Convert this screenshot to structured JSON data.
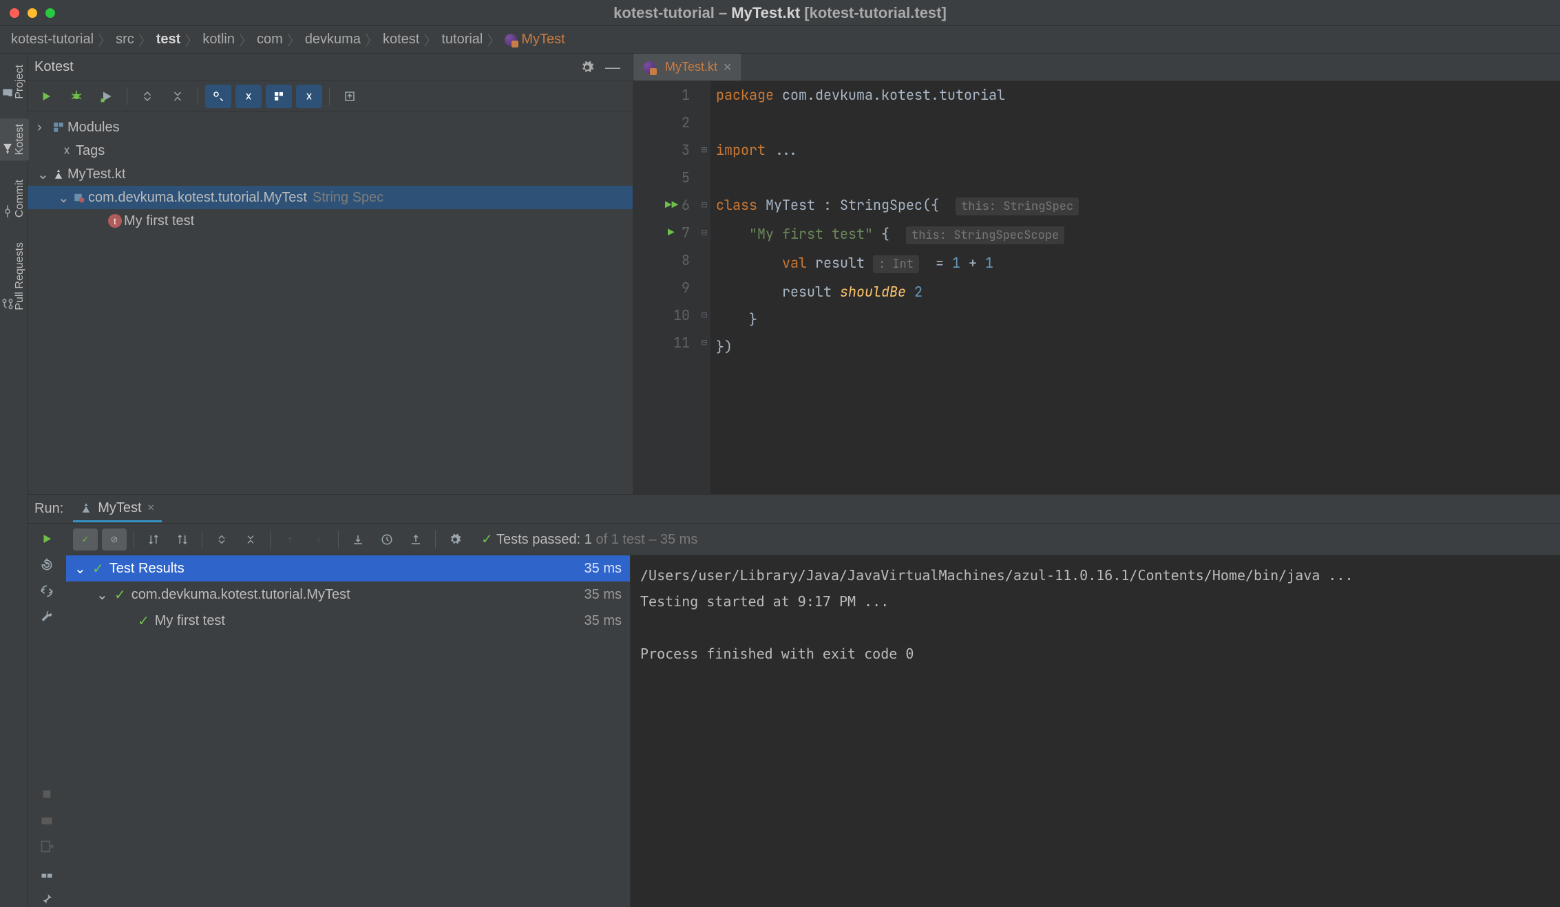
{
  "window": {
    "title_prefix": "kotest-tutorial – ",
    "title_file": "MyTest.kt",
    "title_suffix": " [kotest-tutorial.test]"
  },
  "breadcrumb": {
    "items": [
      "kotest-tutorial",
      "src",
      "test",
      "kotlin",
      "com",
      "devkuma",
      "kotest",
      "tutorial"
    ],
    "active": "MyTest"
  },
  "left_tabs": {
    "project": "Project",
    "kotest": "Kotest",
    "commit": "Commit",
    "pull_requests": "Pull Requests"
  },
  "kotest_panel": {
    "title": "Kotest",
    "tree": {
      "modules": "Modules",
      "tags": "Tags",
      "file": "MyTest.kt",
      "class": "com.devkuma.kotest.tutorial.MyTest",
      "class_spec": "String Spec",
      "test": "My first test"
    }
  },
  "editor": {
    "tab_name": "MyTest.kt",
    "code": {
      "package_kw": "package",
      "package_name": " com.devkuma.kotest.tutorial",
      "import_kw": "import",
      "import_rest": " ...",
      "class_kw": "class",
      "class_name": " MyTest : StringSpec({ ",
      "hint_class": "this: StringSpec",
      "test_str": "\"My first test\"",
      "test_brace": " { ",
      "hint_scope": "this: StringSpecScope",
      "val_kw": "val",
      "val_line": " result ",
      "int_hint": ": Int",
      "val_rest": "  = ",
      "num1": "1",
      "plus": " + ",
      "num2": "1",
      "result1": "result ",
      "shouldbe": "shouldBe",
      "space": " ",
      "num3": "2",
      "close1": "}",
      "close2": "})"
    }
  },
  "run": {
    "label": "Run:",
    "tab_name": "MyTest",
    "tests_passed_label": "Tests passed: ",
    "tests_passed_count": "1",
    "tests_total": " of 1 test – 35 ms",
    "tree": {
      "root": "Test Results",
      "root_time": "35 ms",
      "class": "com.devkuma.kotest.tutorial.MyTest",
      "class_time": "35 ms",
      "test": "My first test",
      "test_time": "35 ms"
    },
    "console": {
      "line1": "/Users/user/Library/Java/JavaVirtualMachines/azul-11.0.16.1/Contents/Home/bin/java ...",
      "line2": "Testing started at 9:17 PM ...",
      "line3": "",
      "line4": "Process finished with exit code 0"
    }
  }
}
